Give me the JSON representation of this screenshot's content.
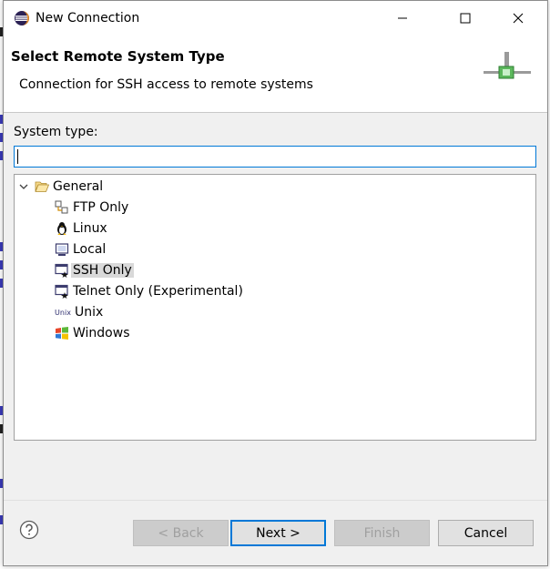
{
  "window": {
    "title": "New Connection"
  },
  "header": {
    "title": "Select Remote System Type",
    "description": "Connection for SSH access to remote systems"
  },
  "form": {
    "system_type_label": "System type:",
    "filter_value": ""
  },
  "tree": {
    "root": {
      "label": "General",
      "expanded": true
    },
    "items": [
      {
        "label": "FTP Only",
        "icon": "ftp-icon"
      },
      {
        "label": "Linux",
        "icon": "linux-penguin-icon"
      },
      {
        "label": "Local",
        "icon": "local-computer-icon"
      },
      {
        "label": "SSH Only",
        "icon": "ssh-terminal-icon",
        "selected": true
      },
      {
        "label": "Telnet Only (Experimental)",
        "icon": "telnet-terminal-icon"
      },
      {
        "label": "Unix",
        "icon": "unix-icon"
      },
      {
        "label": "Windows",
        "icon": "windows-icon"
      }
    ],
    "unix_icon_text": "Unix"
  },
  "buttons": {
    "back": "< Back",
    "next": "Next >",
    "finish": "Finish",
    "cancel": "Cancel"
  },
  "colors": {
    "accent": "#0078d7",
    "selection": "#d9d9d9"
  }
}
